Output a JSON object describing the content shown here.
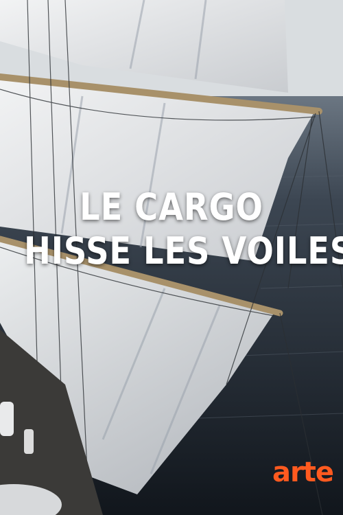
{
  "poster": {
    "title_lines": [
      "LE CARGO",
      "HISSE LES VOILES"
    ],
    "logo": "arte"
  },
  "colors": {
    "sea": "#1d232b",
    "sky": "#d9dde0",
    "sail": "#e6e8ea",
    "spar": "#a8916a",
    "title": "#ffffff",
    "logo": "#ff5a1f"
  }
}
